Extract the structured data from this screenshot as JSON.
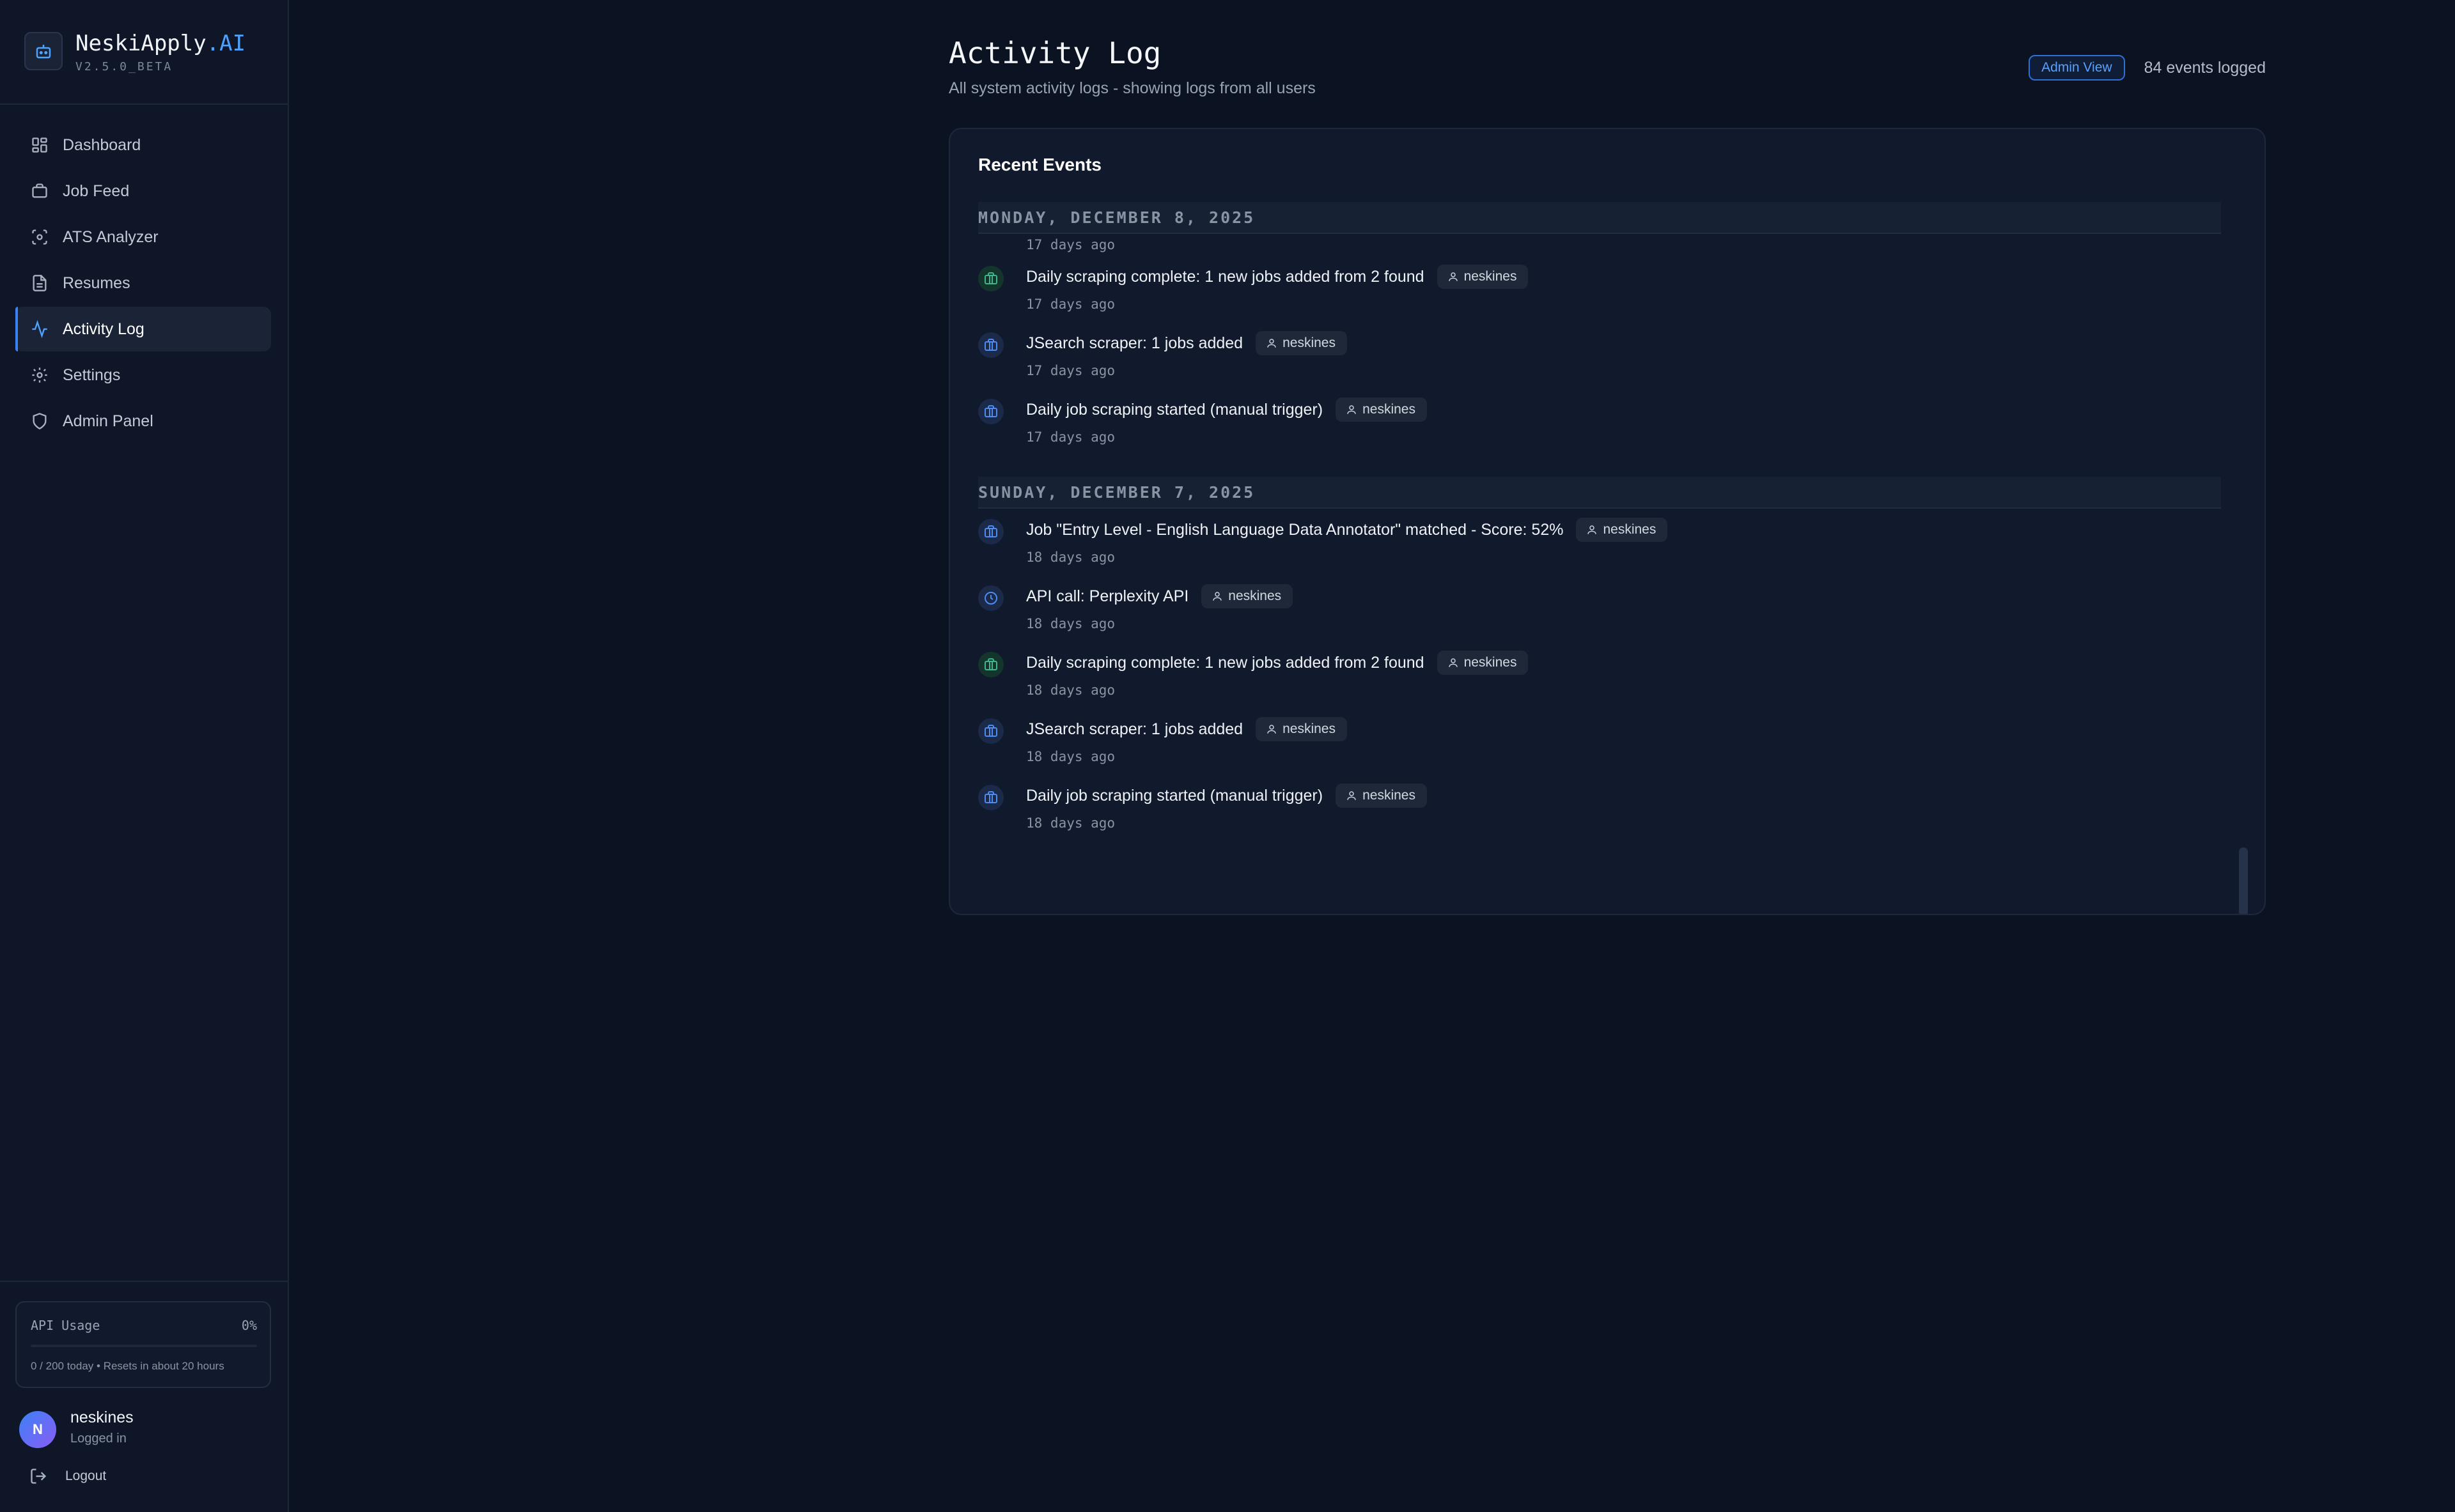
{
  "app": {
    "name_main": "NeskiApply",
    "name_accent": ".AI",
    "version": "V2.5.0_BETA"
  },
  "sidebar": {
    "items": [
      {
        "label": "Dashboard",
        "icon": "dashboard-icon"
      },
      {
        "label": "Job Feed",
        "icon": "briefcase-icon"
      },
      {
        "label": "ATS Analyzer",
        "icon": "scan-icon"
      },
      {
        "label": "Resumes",
        "icon": "document-icon"
      },
      {
        "label": "Activity Log",
        "icon": "activity-icon",
        "active": true
      },
      {
        "label": "Settings",
        "icon": "gear-icon"
      },
      {
        "label": "Admin Panel",
        "icon": "shield-icon"
      }
    ]
  },
  "usage": {
    "label": "API Usage",
    "percent_text": "0%",
    "fraction": 0,
    "subtext": "0 / 200 today • Resets in about 20 hours"
  },
  "user": {
    "initial": "N",
    "name": "neskines",
    "status": "Logged in",
    "logout_label": "Logout"
  },
  "header": {
    "title": "Activity Log",
    "subtitle": "All system activity logs - showing logs from all users",
    "badge": "Admin View",
    "count": "84 events logged"
  },
  "card": {
    "title": "Recent Events"
  },
  "groups": [
    {
      "date": "MONDAY, DECEMBER 8, 2025",
      "partial_time": "17 days ago",
      "events": [
        {
          "message": "Daily scraping complete: 1 new jobs added from 2 found",
          "user": "neskines",
          "time": "17 days ago",
          "icon": "briefcase-icon",
          "color": "green"
        },
        {
          "message": "JSearch scraper: 1 jobs added",
          "user": "neskines",
          "time": "17 days ago",
          "icon": "briefcase-icon",
          "color": "blue"
        },
        {
          "message": "Daily job scraping started (manual trigger)",
          "user": "neskines",
          "time": "17 days ago",
          "icon": "briefcase-icon",
          "color": "blue"
        }
      ]
    },
    {
      "date": "SUNDAY, DECEMBER 7, 2025",
      "events": [
        {
          "message": "Job \"Entry Level - English Language Data Annotator\" matched - Score: 52%",
          "user": "neskines",
          "time": "18 days ago",
          "icon": "briefcase-icon",
          "color": "blue"
        },
        {
          "message": "API call: Perplexity API",
          "user": "neskines",
          "time": "18 days ago",
          "icon": "clock-icon",
          "color": "blue"
        },
        {
          "message": "Daily scraping complete: 1 new jobs added from 2 found",
          "user": "neskines",
          "time": "18 days ago",
          "icon": "briefcase-icon",
          "color": "green"
        },
        {
          "message": "JSearch scraper: 1 jobs added",
          "user": "neskines",
          "time": "18 days ago",
          "icon": "briefcase-icon",
          "color": "blue"
        },
        {
          "message": "Daily job scraping started (manual trigger)",
          "user": "neskines",
          "time": "18 days ago",
          "icon": "briefcase-icon",
          "color": "blue"
        }
      ]
    }
  ],
  "colors": {
    "accent": "#3b82f6",
    "background": "#0b1222",
    "green": "#3fb68b",
    "blue": "#4e8cf0"
  }
}
